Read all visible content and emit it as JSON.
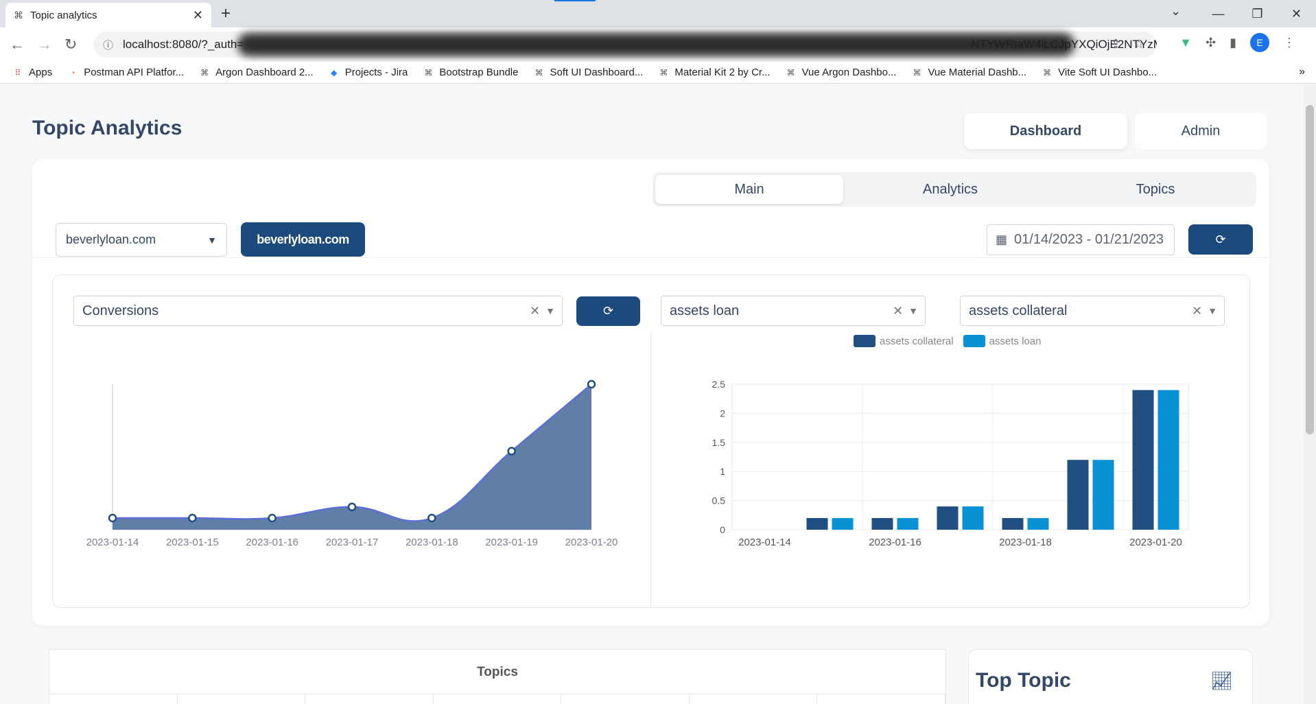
{
  "browser": {
    "tab_title": "Topic analytics",
    "url_visible": "localhost:8080/?_auth=",
    "url_tail": "NTYWRtaW4iLCJpYXQiOjE2NTYzMzE...",
    "avatar_letter": "E",
    "bookmarks": [
      {
        "label": "Apps",
        "icon": "apps-grid-icon"
      },
      {
        "label": "Postman API Platfor...",
        "icon": "postman-icon"
      },
      {
        "label": "Argon Dashboard 2...",
        "icon": "creative-tim-icon"
      },
      {
        "label": "Projects - Jira",
        "icon": "jira-icon"
      },
      {
        "label": "Bootstrap Bundle",
        "icon": "creative-tim-icon"
      },
      {
        "label": "Soft UI Dashboard...",
        "icon": "creative-tim-icon"
      },
      {
        "label": "Material Kit 2 by Cr...",
        "icon": "creative-tim-icon"
      },
      {
        "label": "Vue Argon Dashbo...",
        "icon": "creative-tim-icon"
      },
      {
        "label": "Vue Material Dashb...",
        "icon": "creative-tim-icon"
      },
      {
        "label": "Vite Soft UI Dashbo...",
        "icon": "creative-tim-icon"
      }
    ]
  },
  "page": {
    "title": "Topic Analytics",
    "top_nav": {
      "dashboard": "Dashboard",
      "admin": "Admin"
    },
    "tabs": {
      "main": "Main",
      "analytics": "Analytics",
      "topics": "Topics"
    },
    "site_select": "beverlyloan.com",
    "site_button": "beverlyloan.com",
    "date_range": "01/14/2023 - 01/21/2023",
    "metric_select": "Conversions",
    "topic_select_a": "assets loan",
    "topic_select_b": "assets collateral",
    "topics_panel_title": "Topics",
    "top_topic_title": "Top Topic"
  },
  "colors": {
    "primary": "#1c4a7c",
    "line_fill": "#5f7fa6",
    "line_stroke": "#5b6fd6",
    "bar_dark": "#1f4e80",
    "bar_light": "#0891d4"
  },
  "chart_data": [
    {
      "type": "area",
      "x": [
        "2023-01-14",
        "2023-01-15",
        "2023-01-16",
        "2023-01-17",
        "2023-01-18",
        "2023-01-19",
        "2023-01-20"
      ],
      "values": [
        0,
        0,
        0,
        0.2,
        0,
        1.2,
        2.4
      ],
      "ylim": [
        0,
        2.4
      ]
    },
    {
      "type": "bar",
      "categories": [
        "2023-01-14",
        "2023-01-15",
        "2023-01-16",
        "2023-01-17",
        "2023-01-18",
        "2023-01-19",
        "2023-01-20"
      ],
      "tick_labels": [
        "2023-01-14",
        "2023-01-16",
        "2023-01-18",
        "2023-01-20"
      ],
      "y_ticks": [
        "0",
        "0.5",
        "1",
        "1.5",
        "2",
        "2.5"
      ],
      "series": [
        {
          "name": "assets collateral",
          "values": [
            0,
            0.2,
            0.2,
            0.4,
            0.2,
            1.2,
            2.4
          ]
        },
        {
          "name": "assets loan",
          "values": [
            0,
            0.2,
            0.2,
            0.4,
            0.2,
            1.2,
            2.4
          ]
        }
      ],
      "ylim": [
        0,
        2.5
      ],
      "grid": true,
      "legend": "top"
    }
  ]
}
